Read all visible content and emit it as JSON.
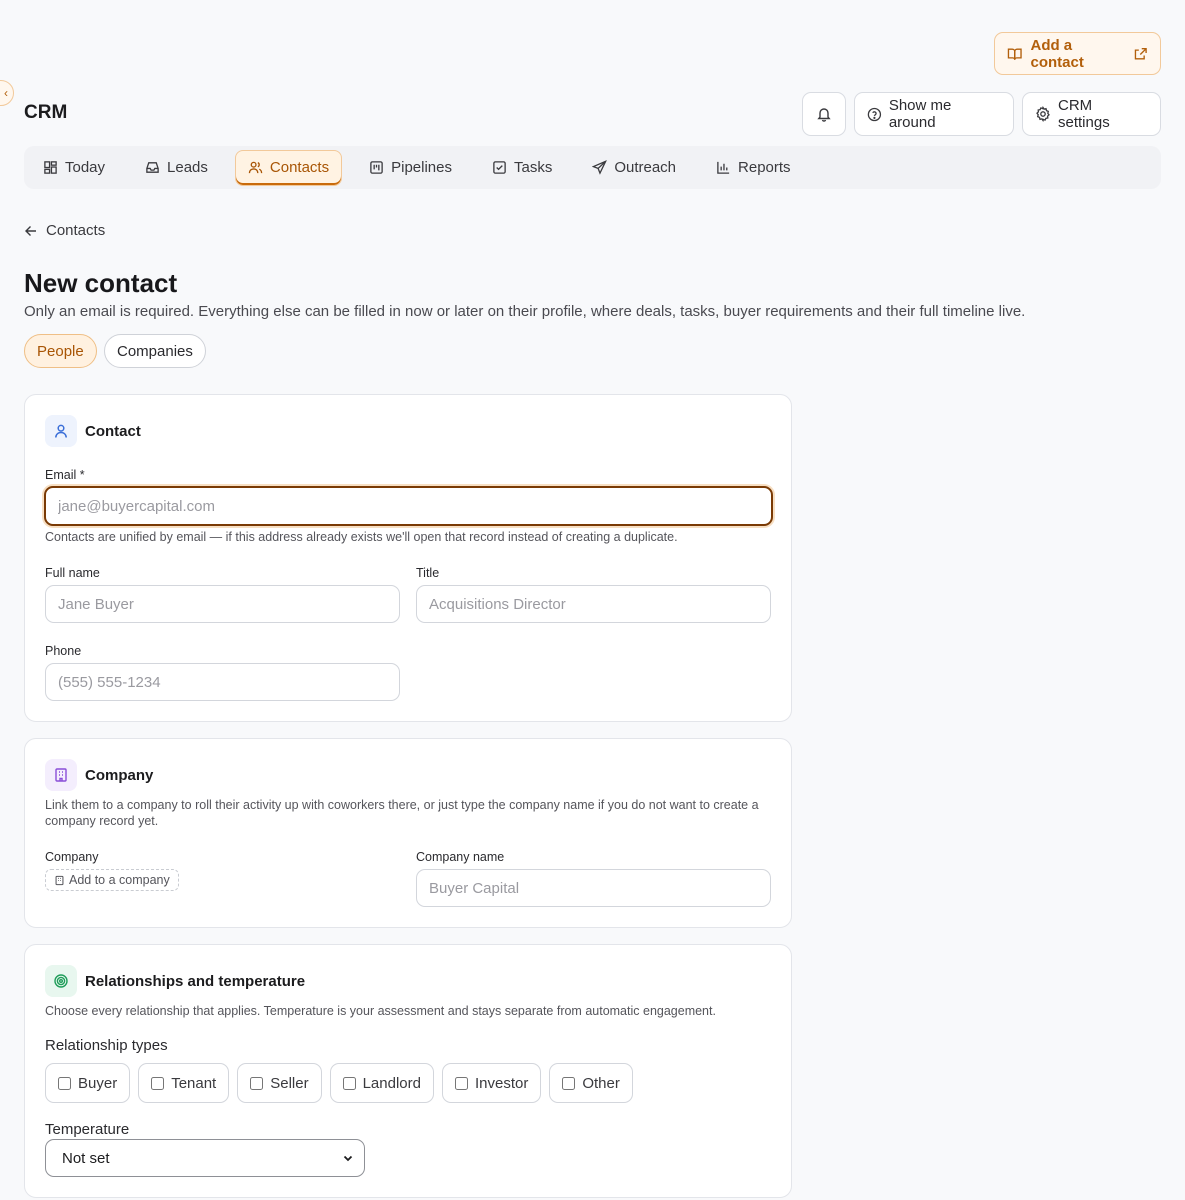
{
  "help": {
    "label": "Add a contact"
  },
  "app": {
    "title": "CRM"
  },
  "header": {
    "show_me_around": "Show me around",
    "settings": "CRM settings"
  },
  "nav": {
    "items": [
      {
        "label": "Today",
        "icon": "dashboard-icon"
      },
      {
        "label": "Leads",
        "icon": "inbox-icon"
      },
      {
        "label": "Contacts",
        "icon": "users-icon",
        "active": true
      },
      {
        "label": "Pipelines",
        "icon": "kanban-icon"
      },
      {
        "label": "Tasks",
        "icon": "check-square-icon"
      },
      {
        "label": "Outreach",
        "icon": "send-icon"
      },
      {
        "label": "Reports",
        "icon": "bar-chart-icon"
      }
    ]
  },
  "back": {
    "label": "Contacts"
  },
  "page": {
    "title": "New contact",
    "subtitle": "Only an email is required. Everything else can be filled in now or later on their profile, where deals, tasks, buyer requirements and their full timeline live."
  },
  "segments": {
    "people": "People",
    "companies": "Companies"
  },
  "contact_card": {
    "title": "Contact",
    "email_label": "Email *",
    "email_placeholder": "jane@buyercapital.com",
    "email_hint": "Contacts are unified by email — if this address already exists we'll open that record instead of creating a duplicate.",
    "full_name_label": "Full name",
    "full_name_placeholder": "Jane Buyer",
    "title_label": "Title",
    "title_placeholder": "Acquisitions Director",
    "phone_label": "Phone",
    "phone_placeholder": "(555) 555-1234"
  },
  "company_card": {
    "title": "Company",
    "desc": "Link them to a company to roll their activity up with coworkers there, or just type the company name if you do not want to create a company record yet.",
    "company_label": "Company",
    "add_company": "Add to a company",
    "company_name_label": "Company name",
    "company_name_placeholder": "Buyer Capital"
  },
  "relationships_card": {
    "title": "Relationships and temperature",
    "desc": "Choose every relationship that applies. Temperature is your assessment and stays separate from automatic engagement.",
    "types_label": "Relationship types",
    "types": [
      "Buyer",
      "Tenant",
      "Seller",
      "Landlord",
      "Investor",
      "Other"
    ],
    "temperature_label": "Temperature",
    "temperature_value": "Not set"
  },
  "colors": {
    "accent": "#b25f0b",
    "accent_bg": "#fff3e3"
  }
}
